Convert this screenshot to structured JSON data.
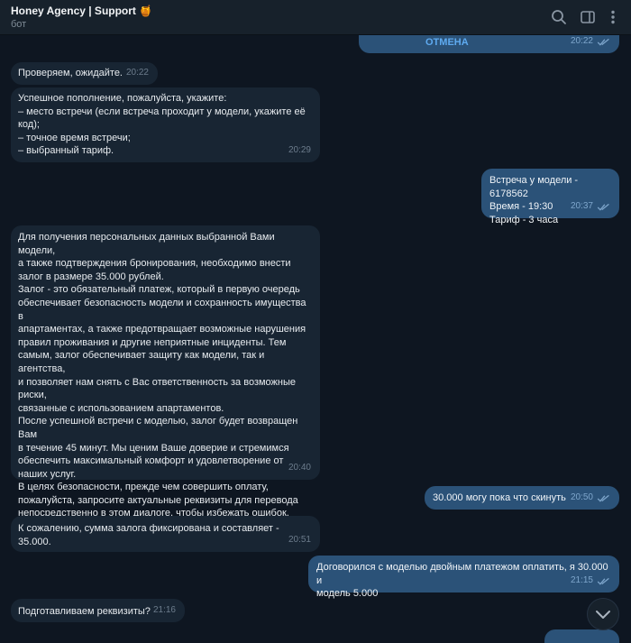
{
  "header": {
    "title": "Honey Agency | Support",
    "title_emoji": "🍯",
    "subtitle": "бот",
    "icons": [
      "search-icon",
      "sidebar-toggle-icon",
      "more-vertical-icon"
    ]
  },
  "messages": [
    {
      "id": "m0",
      "dir": "out",
      "text": "ОТМЕНА",
      "time": "20:22",
      "read": true
    },
    {
      "id": "m1",
      "dir": "in",
      "text": "Проверяем, ожидайте.",
      "time": "20:22"
    },
    {
      "id": "m2",
      "dir": "in",
      "text": "Успешное пополнение, пожалуйста, укажите:\n– место встречи (если встреча проходит у модели, укажите её\nкод);\n– точное время встречи;\n– выбранный тариф.",
      "time": "20:29"
    },
    {
      "id": "m3",
      "dir": "out",
      "text": "Встреча у модели - 6178562\nВремя - 19:30\nТариф - 3 часа",
      "time": "20:37",
      "read": true
    },
    {
      "id": "m4",
      "dir": "in",
      "text": "Для получения персональных данных выбранной Вами модели,\nа также подтверждения бронирования, необходимо внести\nзалог в размере 35.000 рублей.\nЗалог - это обязательный платеж, который в первую очередь\nобеспечивает безопасность модели и сохранность имущества в\nапартаментах, а также предотвращает возможные нарушения\nправил проживания и другие неприятные инциденты. Тем\nсамым, залог обеспечивает защиту как модели, так и агентства,\nи позволяет нам снять с Вас ответственность за возможные\nриски,\nсвязанные с использованием апартаментов.\nПосле успешной встречи с моделью, залог будет возвращен Вам\nв течение 45 минут. Мы ценим Ваше доверие и стремимся\nобеспечить максимальный комфорт и удовлетворение от\nнаших услуг.\nВ целях безопасности, прежде чем совершить оплату,\nпожалуйста, запросите актуальные реквизиты для перевода\nнепосредственно в этом диалоге, чтобы избежать ошибок.",
      "time": "20:40"
    },
    {
      "id": "m5",
      "dir": "out",
      "text": "30.000 могу пока что скинуть",
      "time": "20:50",
      "read": true
    },
    {
      "id": "m6",
      "dir": "in",
      "text": "К сожалению, сумма залога фиксирована и составляет - 35.000.",
      "time": "20:51"
    },
    {
      "id": "m7",
      "dir": "out",
      "text": "Договорился с моделью двойным платежом оплатить, я 30.000 и\nмодель 5.000",
      "time": "21:15",
      "read": true
    },
    {
      "id": "m8",
      "dir": "in",
      "text": "Подготавливаем реквизиты?",
      "time": "21:16"
    }
  ],
  "colors": {
    "background": "#0e1621",
    "header": "#17212b",
    "incoming_bubble": "#182533",
    "outgoing_bubble": "#2b5278",
    "link_blue": "#5eaaf0"
  }
}
